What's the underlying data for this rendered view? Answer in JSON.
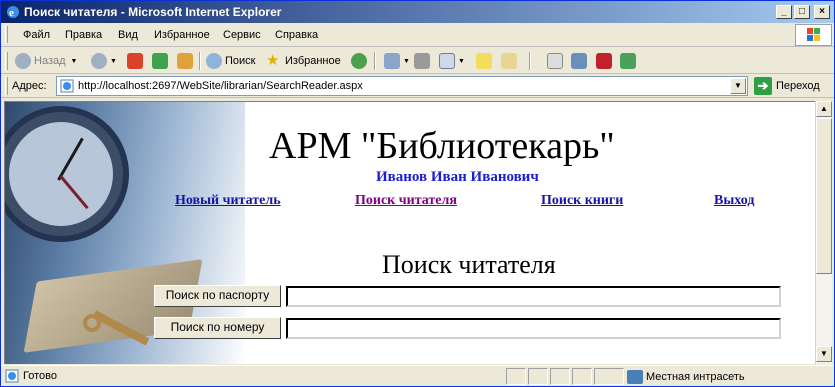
{
  "window": {
    "title": "Поиск читателя - Microsoft Internet Explorer"
  },
  "menu": [
    "Файл",
    "Правка",
    "Вид",
    "Избранное",
    "Сервис",
    "Справка"
  ],
  "toolbar": {
    "back_label": "Назад",
    "search_label": "Поиск",
    "favorites_label": "Избранное"
  },
  "address": {
    "label": "Адрес:",
    "url": "http://localhost:2697/WebSite/librarian/SearchReader.aspx",
    "go_label": "Переход"
  },
  "page": {
    "app_title": "АРМ \"Библиотекарь\"",
    "user_name": "Иванов Иван Иванович",
    "nav": [
      {
        "label": "Новый читатель"
      },
      {
        "label": "Поиск читателя"
      },
      {
        "label": "Поиск книги"
      },
      {
        "label": "Выход"
      }
    ],
    "section_title": "Поиск читателя",
    "search_by_passport": {
      "button_label": "Поиск по паспорту",
      "value": ""
    },
    "search_by_number": {
      "button_label": "Поиск по номеру",
      "value": ""
    }
  },
  "status": {
    "text": "Готово",
    "zone": "Местная интрасеть"
  },
  "colors": {
    "link": "#1414a8",
    "visited_link": "#800080",
    "user_name": "#1c1cd4",
    "titlebar": "#0a246a"
  }
}
